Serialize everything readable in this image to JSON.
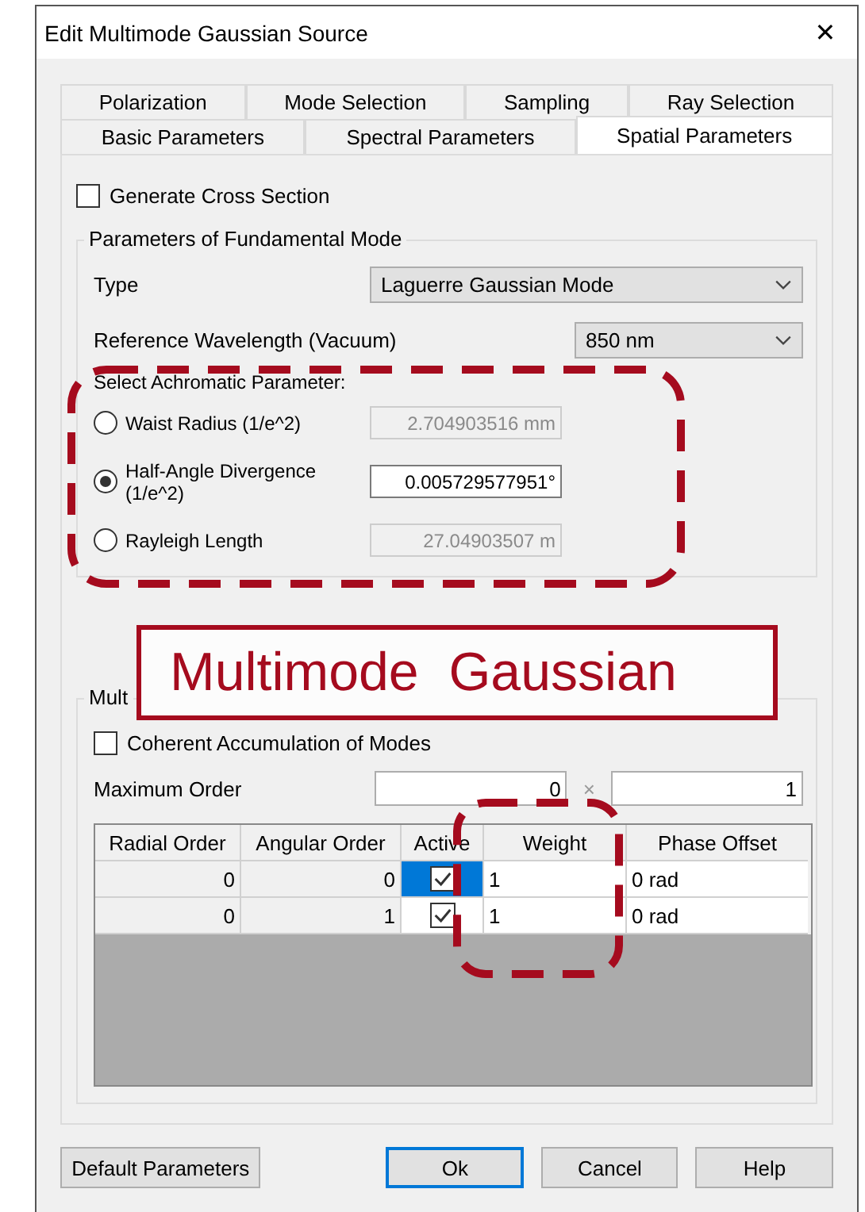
{
  "window": {
    "title": "Edit Multimode Gaussian Source",
    "close": "✕"
  },
  "tab_rows": [
    [
      {
        "label": "Polarization",
        "selected": false
      },
      {
        "label": "Mode Selection",
        "selected": false
      },
      {
        "label": "Sampling",
        "selected": false
      },
      {
        "label": "Ray Selection",
        "selected": false
      }
    ],
    [
      {
        "label": "Basic Parameters",
        "selected": false
      },
      {
        "label": "Spectral Parameters",
        "selected": false
      },
      {
        "label": "Spatial Parameters",
        "selected": true
      }
    ]
  ],
  "generate_cross_section": {
    "label": "Generate Cross Section",
    "checked": false
  },
  "fundamental_mode": {
    "title": "Parameters of Fundamental Mode",
    "type": {
      "label": "Type",
      "value": "Laguerre Gaussian Mode"
    },
    "wavelength": {
      "label": "Reference Wavelength (Vacuum)",
      "value": "850 nm"
    },
    "achromatic_label": "Select Achromatic Parameter:",
    "options": [
      {
        "label": "Waist Radius (1/e^2)",
        "value": "2.704903516 mm",
        "selected": false
      },
      {
        "label": "Half-Angle Divergence (1/e^2)",
        "value": "0.005729577951°",
        "selected": true
      },
      {
        "label": "Rayleigh Length",
        "value": "27.04903507 m",
        "selected": false
      }
    ]
  },
  "multimode": {
    "title": "Mult",
    "coherent": {
      "label": "Coherent Accumulation of Modes",
      "checked": false
    },
    "max_order": {
      "label": "Maximum Order",
      "value_1": "0",
      "separator": "×",
      "value_2": "1"
    },
    "table": {
      "columns": [
        "Radial Order",
        "Angular Order",
        "Active",
        "Weight",
        "Phase Offset"
      ],
      "rows": [
        {
          "radial": "0",
          "angular": "0",
          "active": true,
          "weight": "1",
          "phase": "0 rad",
          "selected": true
        },
        {
          "radial": "0",
          "angular": "1",
          "active": true,
          "weight": "1",
          "phase": "0 rad",
          "selected": false
        }
      ]
    }
  },
  "buttons": [
    {
      "label": "Default Parameters",
      "kind": "left"
    },
    {
      "label": "Ok",
      "kind": "default"
    },
    {
      "label": "Cancel",
      "kind": "normal"
    },
    {
      "label": "Help",
      "kind": "normal"
    }
  ],
  "callout": "Multimode  Gaussian"
}
